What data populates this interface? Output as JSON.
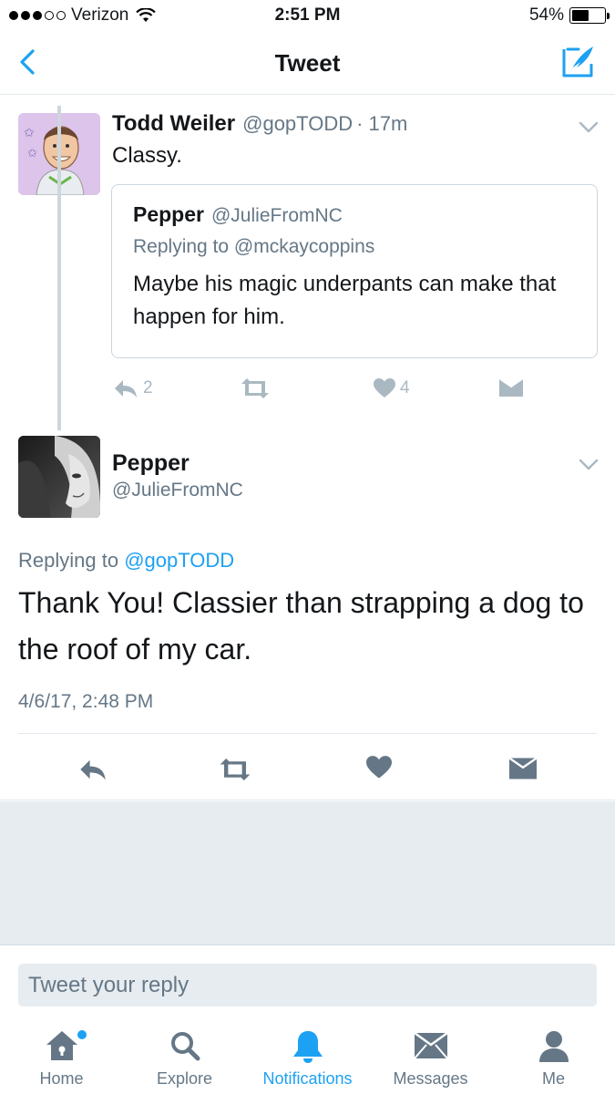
{
  "status_bar": {
    "carrier": "Verizon",
    "time": "2:51 PM",
    "battery": "54%",
    "battery_level": 0.54
  },
  "nav": {
    "title": "Tweet"
  },
  "parent_tweet": {
    "name": "Todd Weiler",
    "handle": "@gopTODD",
    "age": "· 17m",
    "text": "Classy.",
    "quoted": {
      "name": "Pepper",
      "handle": "@JulieFromNC",
      "replying_to": "Replying to @mckaycoppins",
      "text": "Maybe his magic underpants can make that happen for him."
    },
    "reply_count": "2",
    "like_count": "4"
  },
  "main_tweet": {
    "name": "Pepper",
    "handle": "@JulieFromNC",
    "replying_prefix": "Replying to",
    "replying_handle": "@gopTODD",
    "text": "Thank You! Classier than strapping a dog to the roof of my car.",
    "timestamp": "4/6/17, 2:48 PM"
  },
  "reply_box": {
    "placeholder": "Tweet your reply"
  },
  "tabs": [
    {
      "label": "Home",
      "icon": "home-icon"
    },
    {
      "label": "Explore",
      "icon": "search-icon"
    },
    {
      "label": "Notifications",
      "icon": "bell-icon"
    },
    {
      "label": "Messages",
      "icon": "envelope-icon"
    },
    {
      "label": "Me",
      "icon": "person-icon"
    }
  ],
  "colors": {
    "accent": "#1da1f2",
    "secondary_text": "#657786",
    "icon_gray": "#aab8c2",
    "action_gray": "#657786",
    "filler": "#e6ecf0"
  }
}
